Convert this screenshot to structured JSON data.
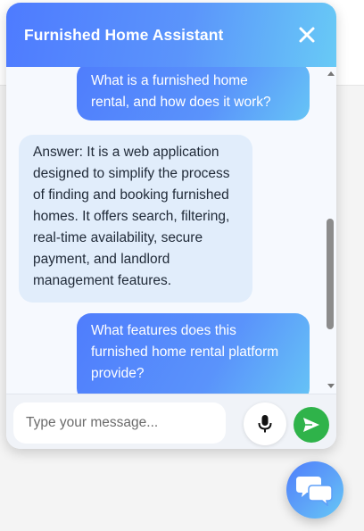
{
  "chat": {
    "title": "Furnished Home Assistant",
    "messages": [
      {
        "role": "user",
        "text": "What is a furnished home\nrental, and how does it work?"
      },
      {
        "role": "bot",
        "text": "Answer: It is a web application\ndesigned to simplify the process\nof finding and booking furnished\nhomes. It offers search, filtering,\nreal-time availability, secure\npayment, and landlord\nmanagement features."
      },
      {
        "role": "user",
        "text": "What features does this\nfurnished home rental platform\nprovide?"
      }
    ],
    "input": {
      "placeholder": "Type your message...",
      "value": ""
    }
  },
  "icons": {
    "close": "close-icon",
    "mic": "microphone-icon",
    "send": "send-icon",
    "launcher": "chat-bubbles-icon"
  },
  "colors": {
    "header_start": "#4e7bff",
    "header_end": "#68caf6",
    "send_button": "#2fb34a",
    "bot_bubble": "#e1edfb"
  }
}
